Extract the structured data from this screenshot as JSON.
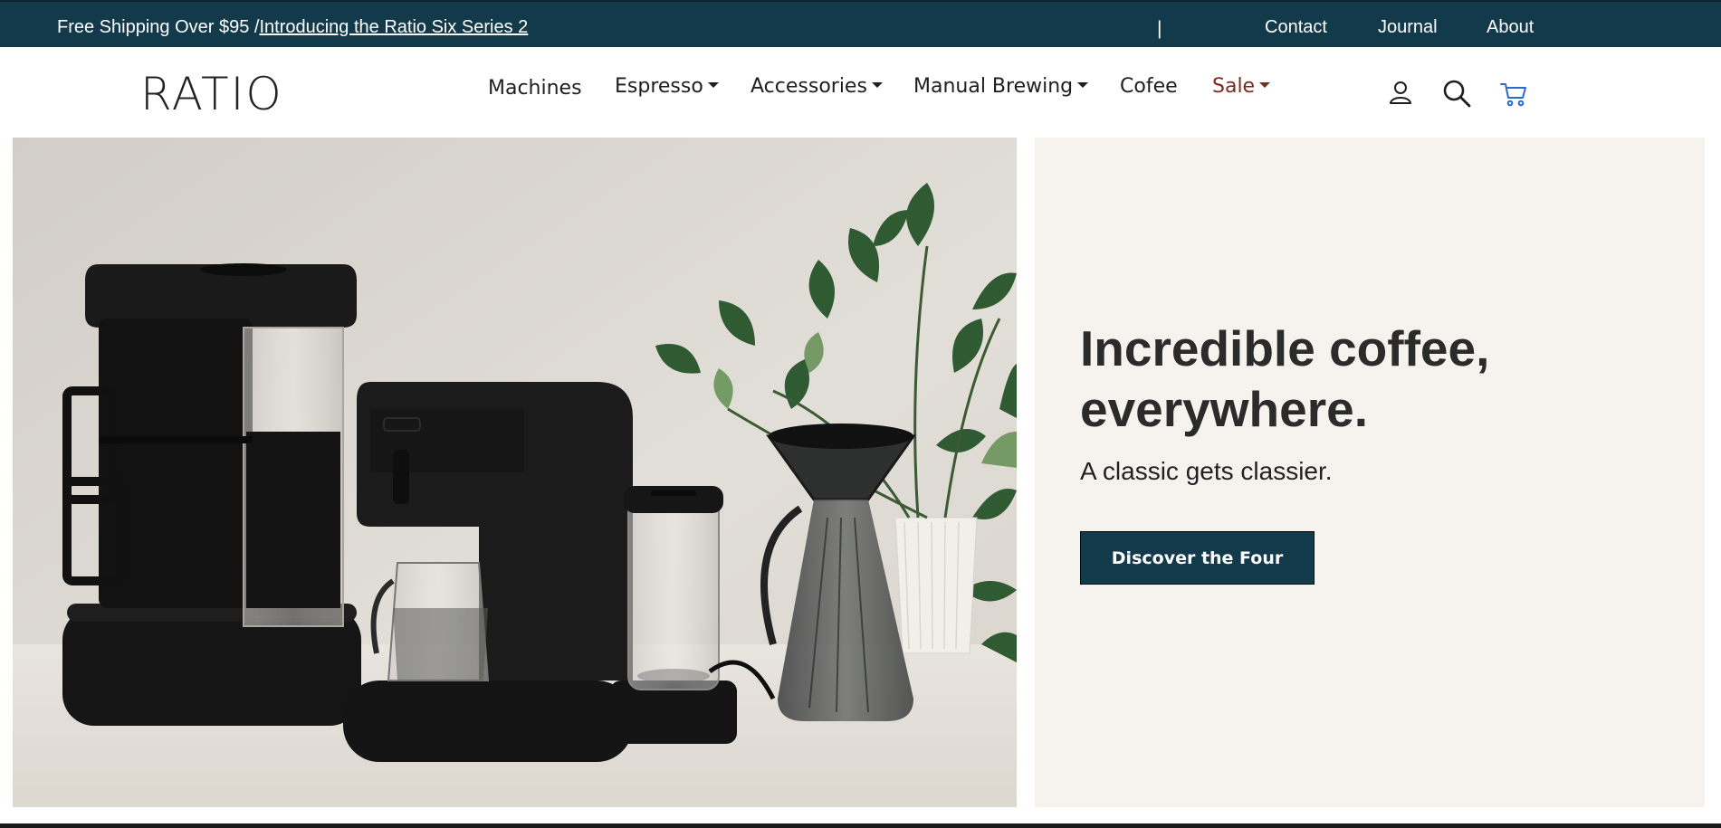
{
  "announcement": {
    "promo_text": "Free Shipping Over $95 /",
    "promo_link": "Introducing the Ratio Six Series 2",
    "separator": "|",
    "links": [
      "Contact",
      "Journal",
      "About"
    ]
  },
  "header": {
    "logo": "RATIO",
    "nav": [
      {
        "label": "Machines",
        "dropdown": false
      },
      {
        "label": "Espresso",
        "dropdown": true
      },
      {
        "label": "Accessories",
        "dropdown": true
      },
      {
        "label": "Manual Brewing",
        "dropdown": true
      },
      {
        "label": "Cofee",
        "dropdown": false
      },
      {
        "label": "Sale",
        "dropdown": true
      }
    ],
    "icons": [
      "account-icon",
      "search-icon",
      "cart-icon"
    ]
  },
  "hero": {
    "headline": "Incredible coffee, everywhere.",
    "subhead": "A classic gets classier.",
    "cta_label": "Discover the Four"
  },
  "colors": {
    "brand_dark": "#133a4a",
    "sale": "#7a2a22",
    "panel_bg": "#f6f3ef",
    "cart_blue": "#2a6ad8"
  }
}
